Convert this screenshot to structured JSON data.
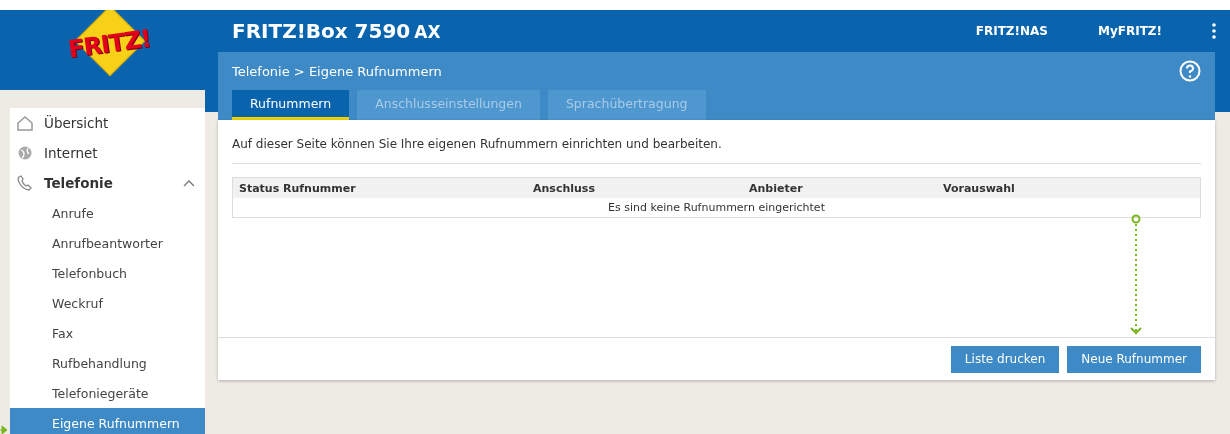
{
  "logo": {
    "text": "FRITZ!"
  },
  "header": {
    "title": "FRITZ!Box 7590",
    "title_suffix": "AX",
    "links": [
      "FRITZ!NAS",
      "MyFRITZ!"
    ]
  },
  "breadcrumb": "Telefonie > Eigene Rufnummern",
  "tabs": [
    {
      "label": "Rufnummern",
      "selected": true
    },
    {
      "label": "Anschlusseinstellungen",
      "selected": false
    },
    {
      "label": "Sprachübertragung",
      "selected": false
    }
  ],
  "sidebar": {
    "items": [
      {
        "label": "Übersicht",
        "expanded": false
      },
      {
        "label": "Internet",
        "expanded": false
      },
      {
        "label": "Telefonie",
        "expanded": true,
        "children": [
          {
            "label": "Anrufe",
            "selected": false
          },
          {
            "label": "Anrufbeantworter",
            "selected": false
          },
          {
            "label": "Telefonbuch",
            "selected": false
          },
          {
            "label": "Weckruf",
            "selected": false
          },
          {
            "label": "Fax",
            "selected": false
          },
          {
            "label": "Rufbehandlung",
            "selected": false
          },
          {
            "label": "Telefoniegeräte",
            "selected": false
          },
          {
            "label": "Eigene Rufnummern",
            "selected": true
          }
        ]
      }
    ]
  },
  "intro": "Auf dieser Seite können Sie Ihre eigenen Rufnummern einrichten und bearbeiten.",
  "table": {
    "columns": [
      "Status",
      "Rufnummer",
      "Anschluss",
      "Anbieter",
      "Vorauswahl"
    ],
    "empty_message": "Es sind keine Rufnummern eingerichtet"
  },
  "buttons": [
    "Liste drucken",
    "Neue Rufnummer"
  ]
}
